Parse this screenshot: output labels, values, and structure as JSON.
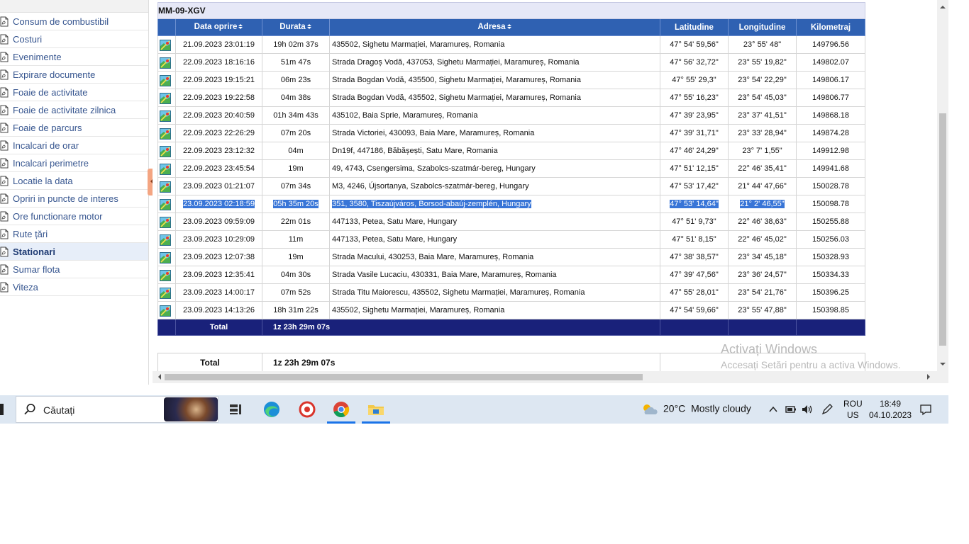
{
  "sidebar": {
    "items": [
      {
        "label": "Consum de combustibil"
      },
      {
        "label": "Costuri"
      },
      {
        "label": "Evenimente"
      },
      {
        "label": "Expirare documente"
      },
      {
        "label": "Foaie de activitate"
      },
      {
        "label": "Foaie de activitate zilnica"
      },
      {
        "label": "Foaie de parcurs"
      },
      {
        "label": "Incalcari de orar"
      },
      {
        "label": "Incalcari perimetre"
      },
      {
        "label": "Locatie la data"
      },
      {
        "label": "Opriri in puncte de interes"
      },
      {
        "label": "Ore functionare motor"
      },
      {
        "label": "Rute țări"
      },
      {
        "label": "Stationari"
      },
      {
        "label": "Sumar flota"
      },
      {
        "label": "Viteza"
      }
    ],
    "active": "Stationari"
  },
  "report": {
    "vehicle": "MM-09-XGV",
    "columns": {
      "date": "Data oprire",
      "duration": "Durata",
      "address": "Adresa",
      "lat": "Latitudine",
      "lon": "Longitudine",
      "km": "Kilometraj"
    },
    "rows": [
      {
        "date": "21.09.2023 23:01:19",
        "duration": "19h 02m 37s",
        "address": "435502, Sighetu Marmației, Maramureș, Romania",
        "lat": "47° 54' 59,56\"",
        "lon": "23° 55' 48\"",
        "km": "149796.56"
      },
      {
        "date": "22.09.2023 18:16:16",
        "duration": "51m 47s",
        "address": "Strada Dragoș Vodă,  437053, Sighetu Marmației, Maramureș, Romania",
        "lat": "47° 56' 32,72\"",
        "lon": "23° 55' 19,82\"",
        "km": "149802.07"
      },
      {
        "date": "22.09.2023 19:15:21",
        "duration": "06m 23s",
        "address": "Strada Bogdan Vodă,  435500, Sighetu Marmației, Maramureș, Romania",
        "lat": "47° 55' 29,3\"",
        "lon": "23° 54' 22,29\"",
        "km": "149806.17"
      },
      {
        "date": "22.09.2023 19:22:58",
        "duration": "04m 38s",
        "address": "Strada Bogdan Vodă,  435502, Sighetu Marmației, Maramureș, Romania",
        "lat": "47° 55' 16,23\"",
        "lon": "23° 54' 45,03\"",
        "km": "149806.77"
      },
      {
        "date": "22.09.2023 20:40:59",
        "duration": "01h 34m 43s",
        "address": "435102, Baia Sprie, Maramureș, Romania",
        "lat": "47° 39' 23,95\"",
        "lon": "23° 37' 41,51\"",
        "km": "149868.18"
      },
      {
        "date": "22.09.2023 22:26:29",
        "duration": "07m 20s",
        "address": "Strada Victoriei,  430093, Baia Mare, Maramureș, Romania",
        "lat": "47° 39' 31,71\"",
        "lon": "23° 33' 28,94\"",
        "km": "149874.28"
      },
      {
        "date": "22.09.2023 23:12:32",
        "duration": "04m",
        "address": "Dn19f,  447186, Băbășești, Satu Mare, Romania",
        "lat": "47° 46' 24,29\"",
        "lon": "23° 7' 1,55\"",
        "km": "149912.98"
      },
      {
        "date": "22.09.2023 23:45:54",
        "duration": "19m",
        "address": "49,  4743, Csengersima, Szabolcs-szatmár-bereg, Hungary",
        "lat": "47° 51' 12,15\"",
        "lon": "22° 46' 35,41\"",
        "km": "149941.68"
      },
      {
        "date": "23.09.2023 01:21:07",
        "duration": "07m 34s",
        "address": "M3,  4246, Újsortanya, Szabolcs-szatmár-bereg, Hungary",
        "lat": "47° 53' 17,42\"",
        "lon": "21° 44' 47,66\"",
        "km": "150028.78"
      },
      {
        "date": "23.09.2023 02:18:59",
        "duration": "05h 35m 20s",
        "address": "351,  3580, Tiszaújváros, Borsod-abaúj-zemplén, Hungary",
        "lat": "47° 53' 14,64\"",
        "lon": "21° 2' 46,55\"",
        "km": "150098.78",
        "selected": true
      },
      {
        "date": "23.09.2023 09:59:09",
        "duration": "22m 01s",
        "address": "447133, Petea, Satu Mare, Hungary",
        "lat": "47° 51' 9,73\"",
        "lon": "22° 46' 38,63\"",
        "km": "150255.88"
      },
      {
        "date": "23.09.2023 10:29:09",
        "duration": "11m",
        "address": "447133, Petea, Satu Mare, Hungary",
        "lat": "47° 51' 8,15\"",
        "lon": "22° 46' 45,02\"",
        "km": "150256.03"
      },
      {
        "date": "23.09.2023 12:07:38",
        "duration": "19m",
        "address": "Strada Macului,  430253, Baia Mare, Maramureș, Romania",
        "lat": "47° 38' 38,57\"",
        "lon": "23° 34' 45,18\"",
        "km": "150328.93"
      },
      {
        "date": "23.09.2023 12:35:41",
        "duration": "04m 30s",
        "address": "Strada Vasile Lucaciu,  430331, Baia Mare, Maramureș, Romania",
        "lat": "47° 39' 47,56\"",
        "lon": "23° 36' 24,57\"",
        "km": "150334.33"
      },
      {
        "date": "23.09.2023 14:00:17",
        "duration": "07m 52s",
        "address": "Strada Titu Maiorescu,  435502, Sighetu Marmației, Maramureș, Romania",
        "lat": "47° 55' 28,01\"",
        "lon": "23° 54' 21,76\"",
        "km": "150396.25"
      },
      {
        "date": "23.09.2023 14:13:26",
        "duration": "18h 31m 22s",
        "address": "435502, Sighetu Marmației, Maramureș, Romania",
        "lat": "47° 54' 59,66\"",
        "lon": "23° 55' 47,88\"",
        "km": "150398.85"
      }
    ],
    "total_label": "Total",
    "total_value": "1z 23h 29m 07s",
    "grand_total_label": "Total",
    "grand_total_value": "1z 23h 29m 07s"
  },
  "watermark": {
    "line1": "Activați Windows",
    "line2": "Accesați Setări pentru a activa Windows."
  },
  "taskbar": {
    "search_text": "Căutați",
    "weather_temp": "20°C",
    "weather_text": "Mostly cloudy",
    "lang_top": "ROU",
    "lang_bottom": "US",
    "time": "18:49",
    "date": "04.10.2023"
  },
  "colors": {
    "header_blue": "#2f61b2",
    "total_navy": "#19217a",
    "selection": "#3875d7",
    "sidebar_link": "#36558f"
  }
}
